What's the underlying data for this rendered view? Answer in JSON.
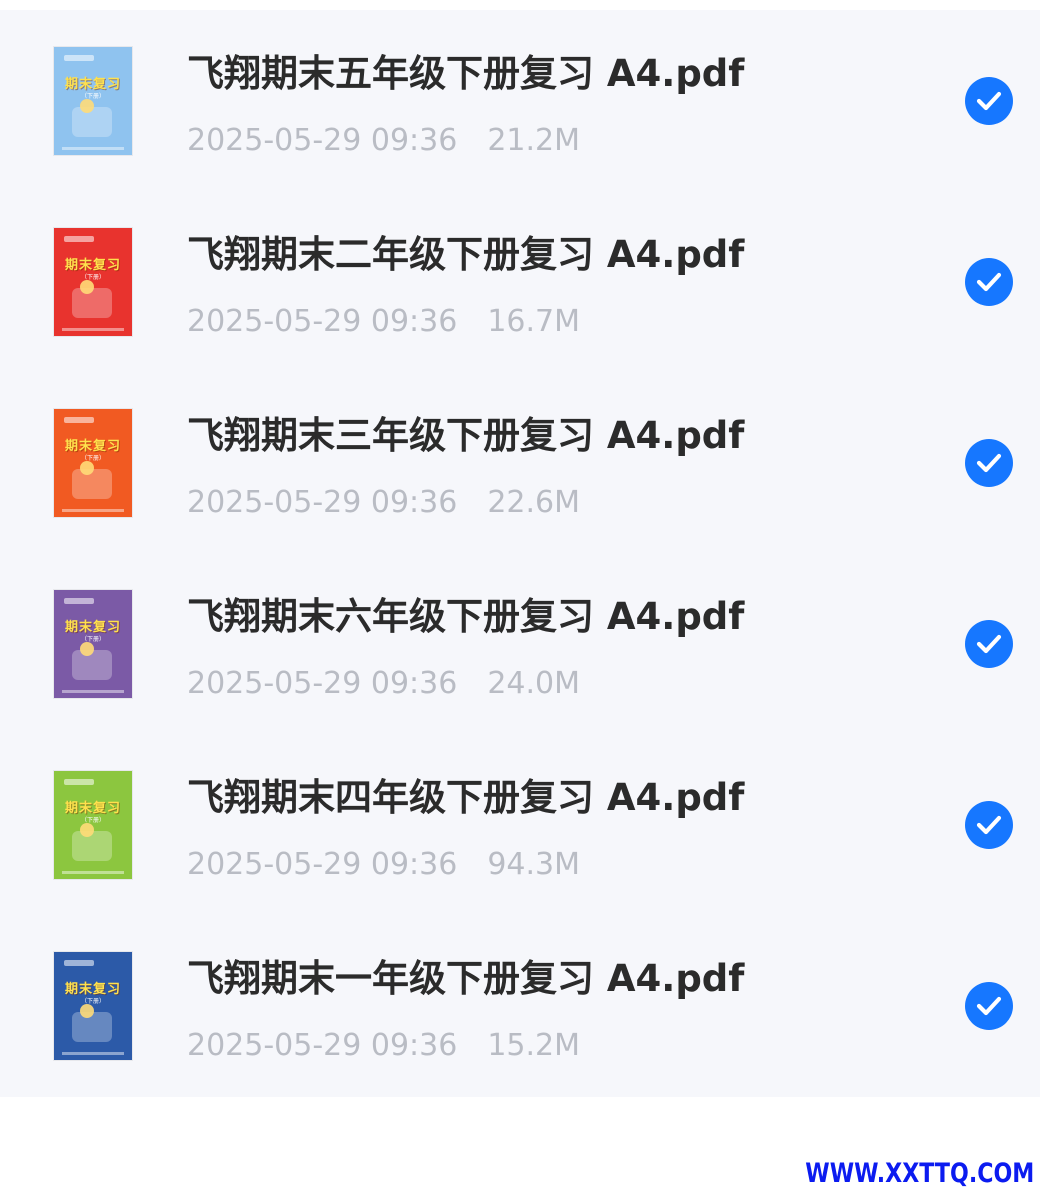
{
  "files": [
    {
      "name": "飞翔期末五年级下册复习 A4.pdf",
      "date": "2025-05-29 09:36",
      "size": "21.2M",
      "cover_color": "#8fc3ef",
      "cover_title": "期末复习",
      "cover_vol": "（下册）",
      "checked": true
    },
    {
      "name": "飞翔期末二年级下册复习 A4.pdf",
      "date": "2025-05-29 09:36",
      "size": "16.7M",
      "cover_color": "#e8332e",
      "cover_title": "期末复习",
      "cover_vol": "（下册）",
      "checked": true
    },
    {
      "name": "飞翔期末三年级下册复习 A4.pdf",
      "date": "2025-05-29 09:36",
      "size": "22.6M",
      "cover_color": "#f15a22",
      "cover_title": "期末复习",
      "cover_vol": "（下册）",
      "checked": true
    },
    {
      "name": "飞翔期末六年级下册复习 A4.pdf",
      "date": "2025-05-29 09:36",
      "size": "24.0M",
      "cover_color": "#7b5aa6",
      "cover_title": "期末复习",
      "cover_vol": "（下册）",
      "checked": true
    },
    {
      "name": "飞翔期末四年级下册复习 A4.pdf",
      "date": "2025-05-29 09:36",
      "size": "94.3M",
      "cover_color": "#8cc63f",
      "cover_title": "期末复习",
      "cover_vol": "（下册）",
      "checked": true
    },
    {
      "name": "飞翔期末一年级下册复习 A4.pdf",
      "date": "2025-05-29 09:36",
      "size": "15.2M",
      "cover_color": "#2c5aa8",
      "cover_title": "期末复习",
      "cover_vol": "（下册）",
      "checked": true
    }
  ],
  "check_icon": "check-circle-icon",
  "accent_color": "#1677ff",
  "watermark": "WWW.XXTTQ.COM"
}
